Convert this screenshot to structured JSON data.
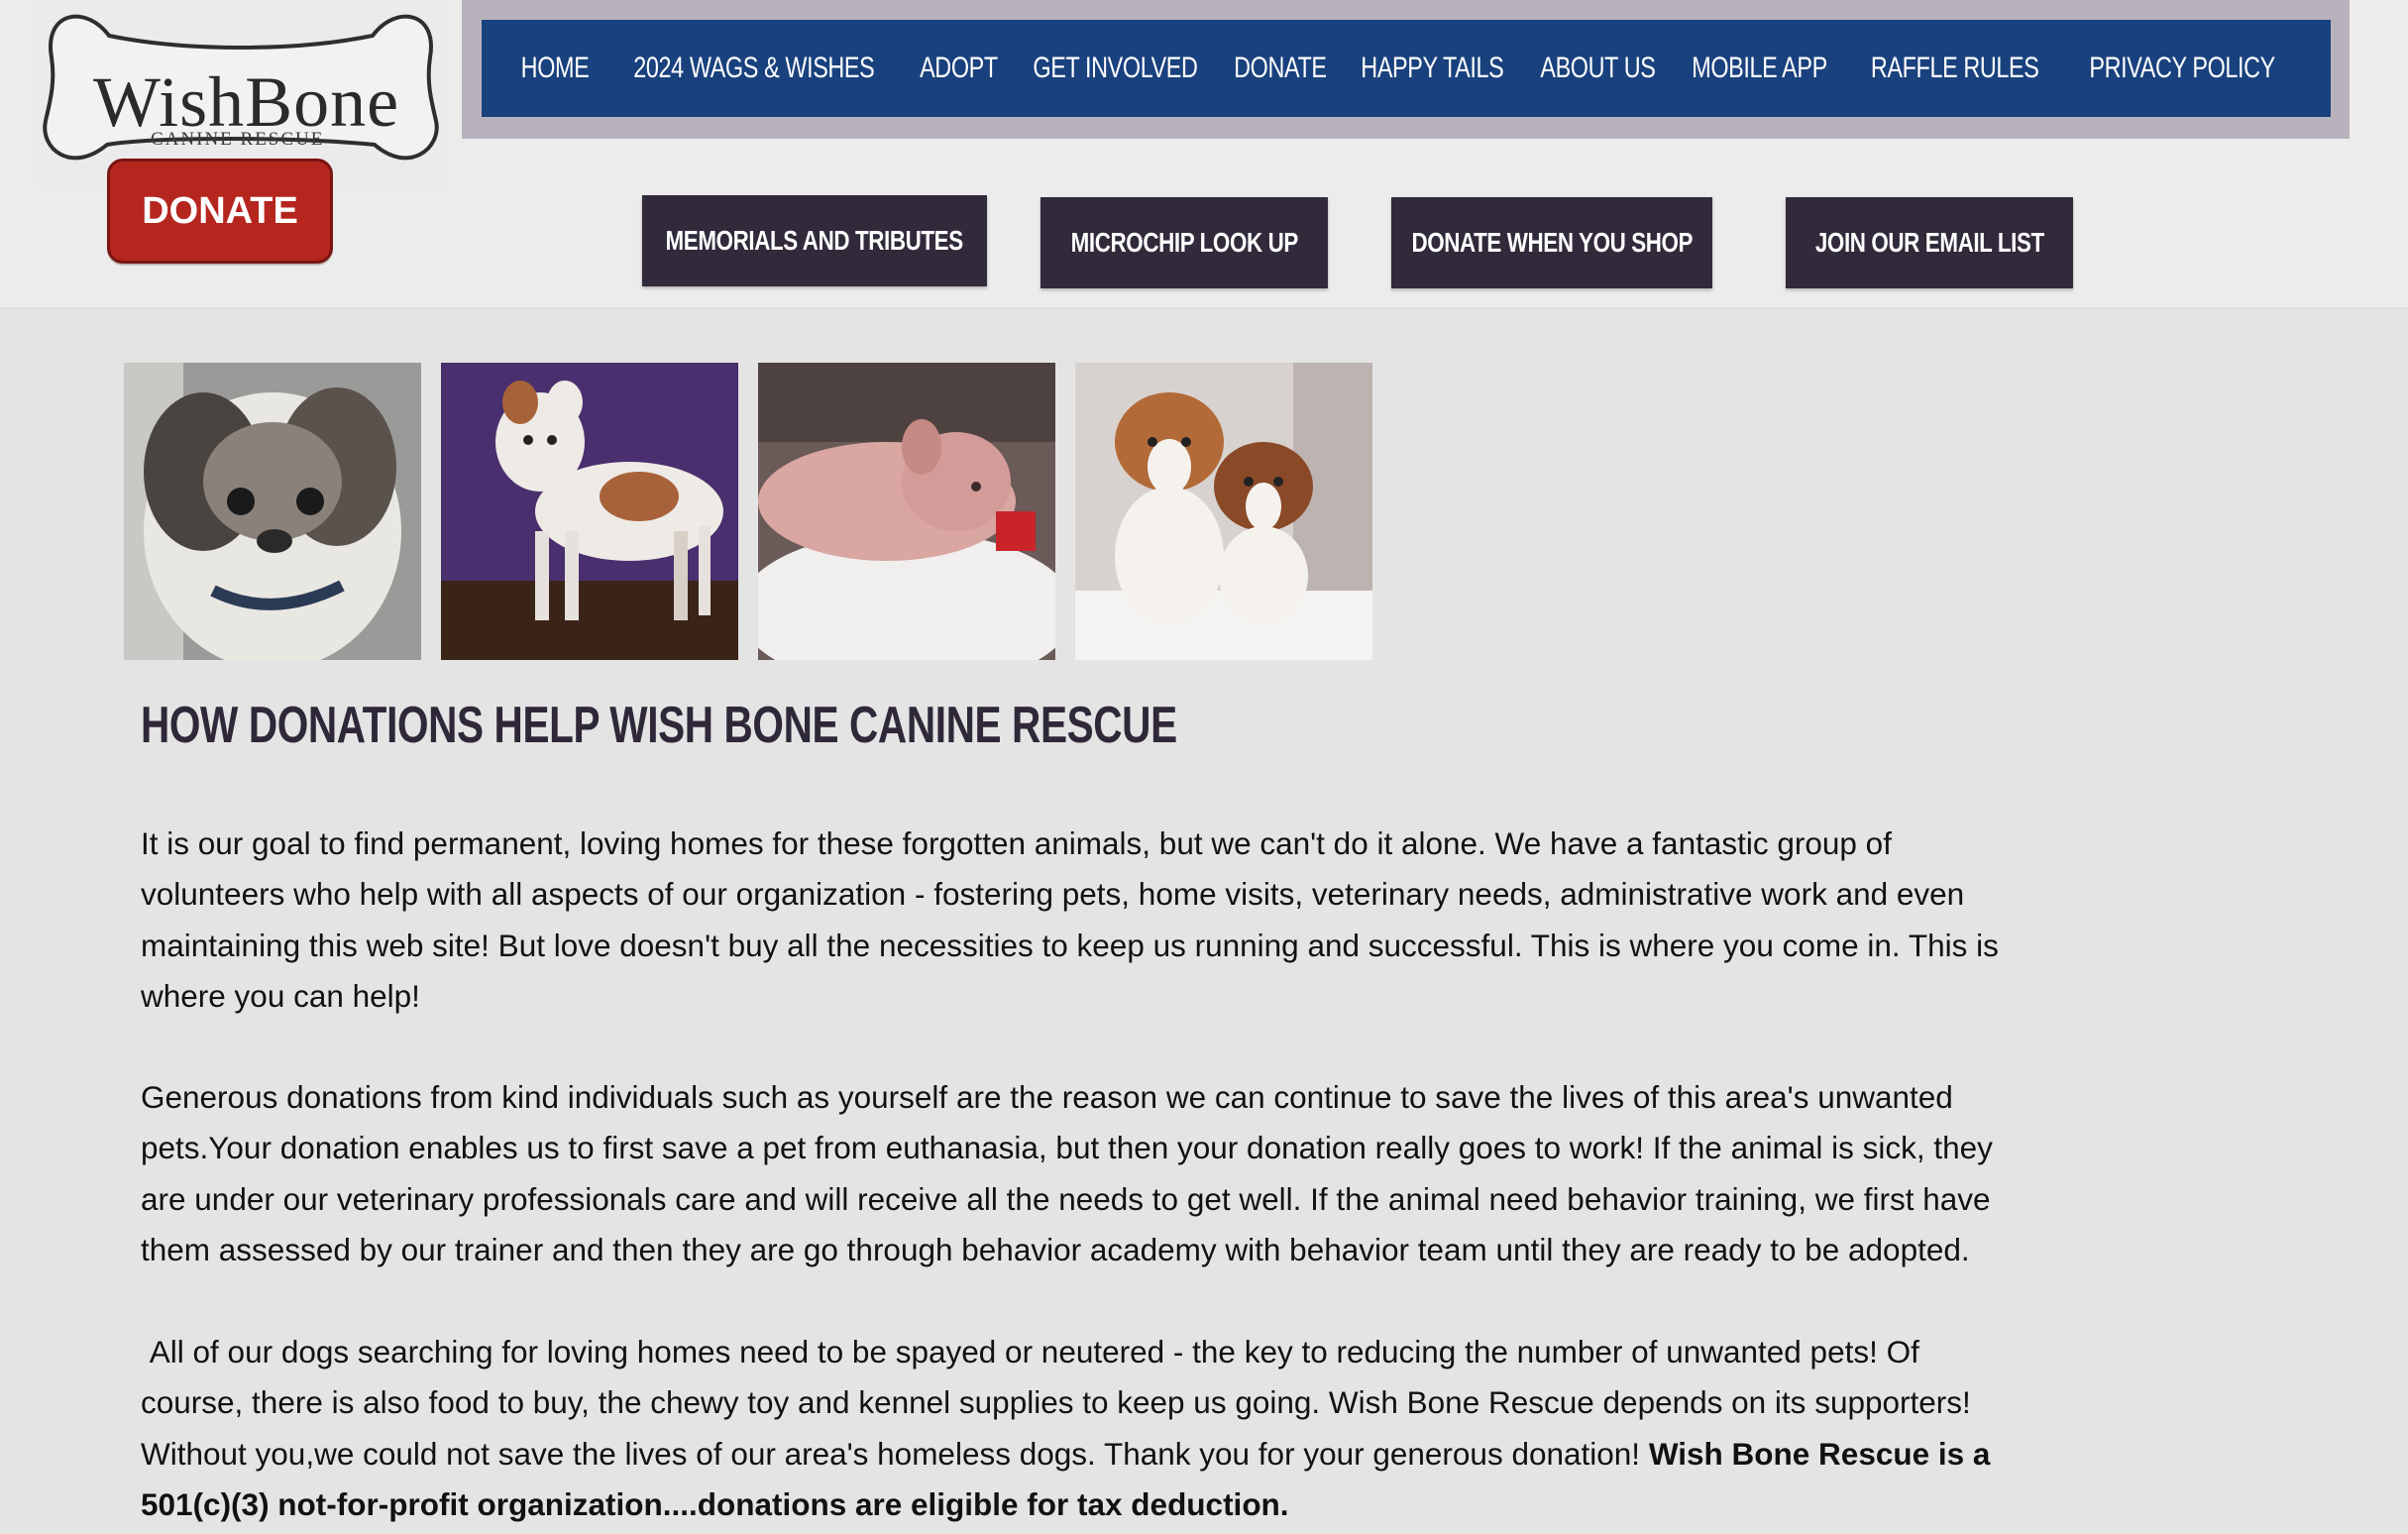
{
  "logo": {
    "title": "WishBone",
    "subtitle": "CANINE RESCUE"
  },
  "donate_button": "DONATE",
  "nav": {
    "items": [
      "HOME",
      "2024 WAGS & WISHES",
      "ADOPT",
      "GET INVOLVED",
      "DONATE",
      "HAPPY TAILS",
      "ABOUT US",
      "MOBILE APP",
      "RAFFLE RULES",
      "PRIVACY POLICY"
    ],
    "bar_color": "#19417e"
  },
  "secondary_nav": [
    "MEMORIALS AND TRIBUTES",
    "MICROCHIP LOOK UP",
    "DONATE WHEN YOU SHOP",
    "JOIN OUR EMAIL LIST"
  ],
  "photos": [
    "shih-tzu-photo",
    "pit-bull-photo",
    "hairless-puppy-photo",
    "two-puppies-photo"
  ],
  "content": {
    "heading": "HOW DONATIONS HELP WISH BONE CANINE RESCUE",
    "paragraph1": "It is our goal to find permanent, loving homes for these forgotten animals, but we can't do it alone. We have a fantastic group of volunteers who help with all aspects of our organization - fostering pets, home visits, veterinary needs, administrative work and even maintaining this web site! But love doesn't buy all the necessities to keep us running and successful. This is where you come in. This is where you can help!",
    "paragraph2": "Generous donations from kind individuals such as yourself are the reason we can continue to save the lives of this area's unwanted pets.Your donation enables us to first save a pet from euthanasia, but then your donation really goes to work! If the animal is sick, they are under our veterinary professionals care and will receive all the needs to get well. If the animal need behavior training, we first have them assessed by our trainer and then they are go through behavior academy with behavior team until they are ready to be adopted.",
    "paragraph3": " All of our dogs searching for loving homes need to be spayed or neutered - the key to reducing the number of unwanted pets! Of course, there is also food to buy, the chewy toy and kennel supplies to keep us going. Wish Bone Rescue depends on its supporters! Without you,we could not save the lives of our area's homeless dogs. Thank you for your generous donation! ",
    "paragraph3_bold": "Wish Bone Rescue is a 501(c)(3) not-for-profit organization....donations are eligible for tax deduction."
  }
}
